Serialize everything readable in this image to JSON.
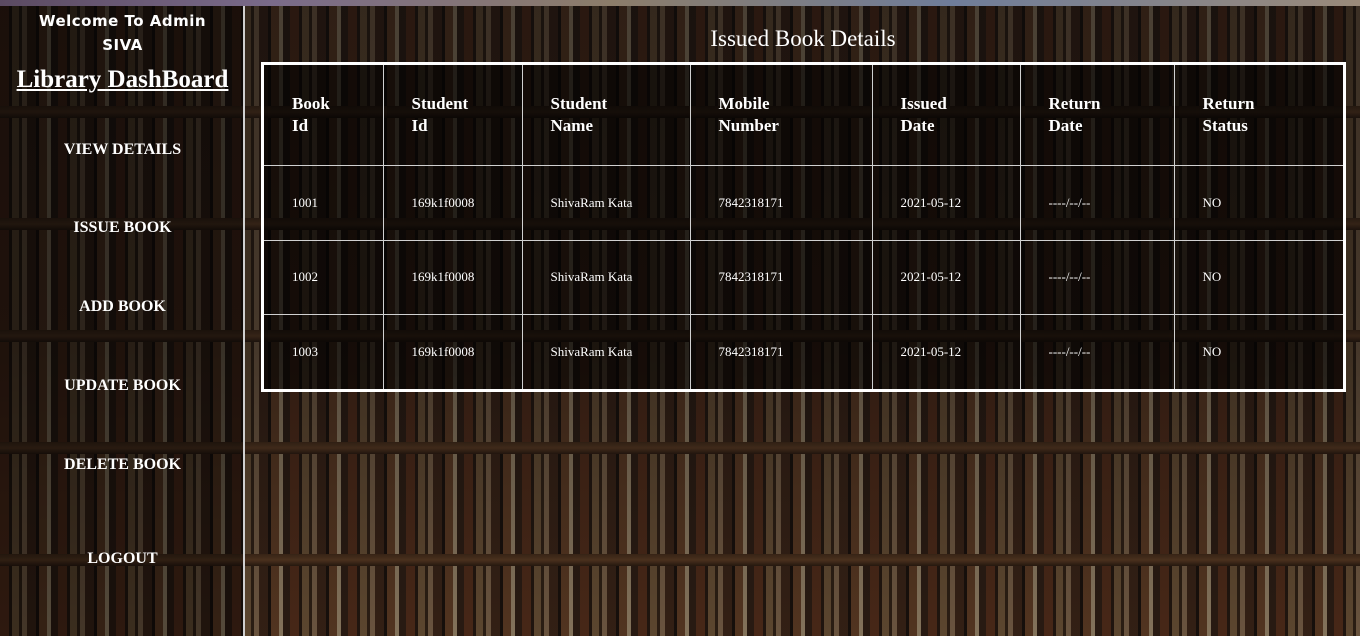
{
  "sidebar": {
    "welcome_line1": "Welcome To Admin",
    "welcome_line2": "SIVA",
    "dashboard_title": "Library DashBoard",
    "nav": [
      {
        "label": "VIEW DETAILS"
      },
      {
        "label": "ISSUE BOOK"
      },
      {
        "label": "ADD BOOK"
      },
      {
        "label": "UPDATE BOOK"
      },
      {
        "label": "DELETE BOOK"
      },
      {
        "label": "LOGOUT"
      }
    ]
  },
  "main": {
    "title": "Issued Book Details",
    "table": {
      "headers": [
        [
          "Book",
          "Id"
        ],
        [
          "Student",
          "Id"
        ],
        [
          "Student",
          "Name"
        ],
        [
          "Mobile",
          "Number"
        ],
        [
          "Issued",
          "Date"
        ],
        [
          "Return",
          "Date"
        ],
        [
          "Return",
          "Status"
        ]
      ],
      "rows": [
        [
          "1001",
          "169k1f0008",
          "ShivaRam Kata",
          "7842318171",
          "2021-05-12",
          "----/--/--",
          "NO"
        ],
        [
          "1002",
          "169k1f0008",
          "ShivaRam Kata",
          "7842318171",
          "2021-05-12",
          "----/--/--",
          "NO"
        ],
        [
          "1003",
          "169k1f0008",
          "ShivaRam Kata",
          "7842318171",
          "2021-05-12",
          "----/--/--",
          "NO"
        ]
      ]
    }
  }
}
